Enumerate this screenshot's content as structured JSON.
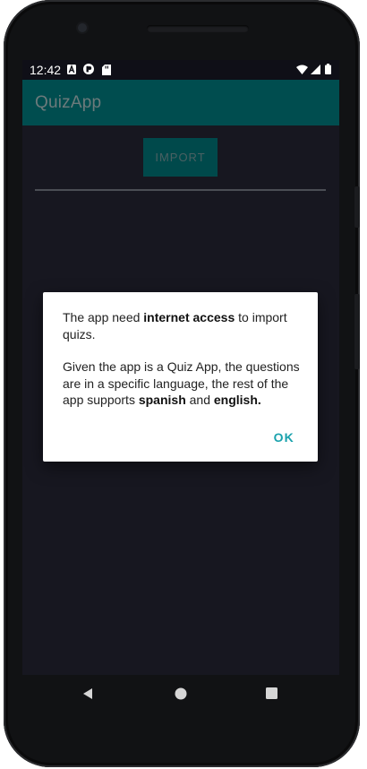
{
  "status_bar": {
    "time": "12:42",
    "left_icons": [
      "a-notification-icon",
      "app-notification-icon",
      "sd-card-icon"
    ],
    "right_icons": [
      "wifi-icon",
      "cell-signal-icon",
      "battery-icon"
    ]
  },
  "app_bar": {
    "title": "QuizApp",
    "color": "#004d4f"
  },
  "main": {
    "import_label": "IMPORT"
  },
  "dialog": {
    "para1": {
      "before": "The app need ",
      "bold": "internet access",
      "after": " to import quizs."
    },
    "para2": {
      "before": "Given the app is a Quiz App, the questions are in a specific language, the rest of the app supports ",
      "bold1": "spanish",
      "middle": " and ",
      "bold2": "english."
    },
    "ok_label": "OK",
    "accent": "#1aa2ad"
  },
  "nav_bar": {
    "icons": [
      "back-icon",
      "home-icon",
      "recents-icon"
    ]
  }
}
